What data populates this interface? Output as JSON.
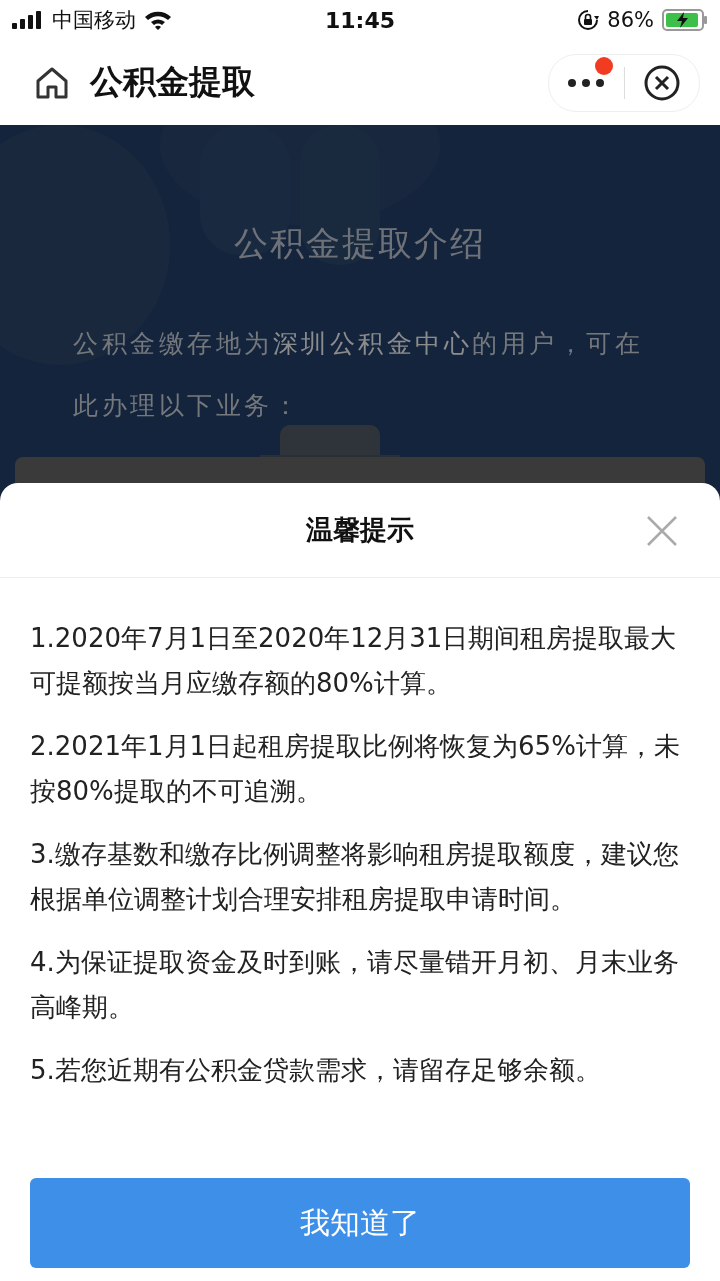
{
  "status_bar": {
    "carrier": "中国移动",
    "time": "11:45",
    "battery": "86%"
  },
  "nav": {
    "title": "公积金提取",
    "notification": true
  },
  "intro": {
    "title": "公积金提取介绍",
    "text": "公积金缴存地为**深圳公积金中心**的用户，可在此办理以下业务："
  },
  "dialog": {
    "title": "温馨提示",
    "items": [
      "1.2020年7月1日至2020年12月31日期间租房提取最大可提额按当月应缴存额的80%计算。",
      "2.2021年1月1日起租房提取比例将恢复为65%计算，未按80%提取的不可追溯。",
      "3.缴存基数和缴存比例调整将影响租房提取额度，建议您根据单位调整计划合理安排租房提取申请时间。",
      "4.为保证提取资金及时到账，请尽量错开月初、月末业务高峰期。",
      "5.若您近期有公积金贷款需求，请留存足够余额。"
    ],
    "button": "我知道了"
  }
}
